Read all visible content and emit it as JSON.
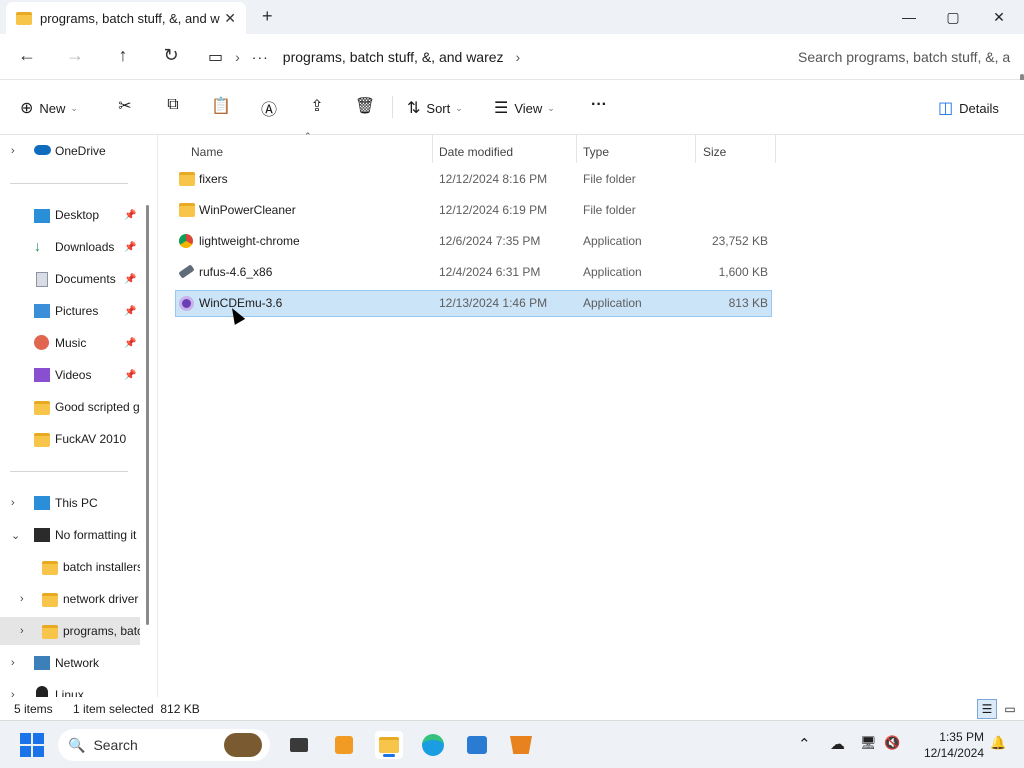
{
  "window": {
    "tab_title": "programs, batch stuff, &, and warez",
    "new_tab_glyph": "+",
    "tab_close_glyph": "✕",
    "minimize_glyph": "—",
    "maximize_glyph": "▢",
    "close_glyph": "✕"
  },
  "address": {
    "back_glyph": "←",
    "forward_glyph": "→",
    "up_glyph": "↑",
    "refresh_glyph": "↻",
    "monitor_glyph": "▭",
    "more_glyph": "···",
    "chevron_glyph": "›",
    "current_folder": "programs, batch stuff, &, and warez",
    "search_placeholder": "Search programs, batch stuff, &, a"
  },
  "commands": {
    "new_label": "New",
    "sort_label": "Sort",
    "view_label": "View",
    "details_label": "Details",
    "more_glyph": "···",
    "new_glyph": "⊕",
    "cut_glyph": "✂",
    "copy_glyph": "⧉",
    "paste_glyph": "📋",
    "rename_glyph": "Ⓐ",
    "share_glyph": "⇪",
    "delete_glyph": "🗑",
    "sort_glyph": "⇅",
    "view_glyph": "☰",
    "details_glyph": "◫",
    "caret": "⌄"
  },
  "sidebar": {
    "items": [
      {
        "label": "OneDrive",
        "chevron": "›"
      },
      {
        "label": "Desktop",
        "pin": "📌"
      },
      {
        "label": "Downloads",
        "pin": "📌"
      },
      {
        "label": "Documents",
        "pin": "📌"
      },
      {
        "label": "Pictures",
        "pin": "📌"
      },
      {
        "label": "Music",
        "pin": "📌"
      },
      {
        "label": "Videos",
        "pin": "📌"
      },
      {
        "label": "Good scripted g"
      },
      {
        "label": "FuckAV 2010"
      },
      {
        "label": "This PC",
        "chevron": "›"
      },
      {
        "label": "No formatting it",
        "chevron": "⌄"
      },
      {
        "label": "batch installers"
      },
      {
        "label": "network driver",
        "chevron": "›"
      },
      {
        "label": "programs, batc",
        "chevron": "›"
      },
      {
        "label": "Network",
        "chevron": "›"
      },
      {
        "label": "Linux",
        "chevron": "›"
      }
    ]
  },
  "columns": {
    "name": "Name",
    "date": "Date modified",
    "type": "Type",
    "size": "Size",
    "sort_glyph": "⌃"
  },
  "files": [
    {
      "name": "fixers",
      "date": "12/12/2024 8:16 PM",
      "type": "File folder",
      "size": "",
      "icon": "folder-icon"
    },
    {
      "name": "WinPowerCleaner",
      "date": "12/12/2024 6:19 PM",
      "type": "File folder",
      "size": "",
      "icon": "folder-icon"
    },
    {
      "name": "lightweight-chrome",
      "date": "12/6/2024 7:35 PM",
      "type": "Application",
      "size": "23,752 KB",
      "icon": "chrome-icon"
    },
    {
      "name": "rufus-4.6_x86",
      "date": "12/4/2024 6:31 PM",
      "type": "Application",
      "size": "1,600 KB",
      "icon": "usb-drive-icon"
    },
    {
      "name": "WinCDEmu-3.6",
      "date": "12/13/2024 1:46 PM",
      "type": "Application",
      "size": "813 KB",
      "icon": "disc-icon"
    }
  ],
  "status": {
    "item_count": "5 items",
    "selection": "1 item selected  812 KB"
  },
  "taskbar": {
    "search_label": "Search",
    "search_glyph": "🔍",
    "time": "1:35 PM",
    "date": "12/14/2024",
    "tray_up_glyph": "⌃",
    "tray_cloud_glyph": "☁",
    "tray_net_glyph": "🖥",
    "tray_vol_glyph": "🔇",
    "tray_bell_glyph": "🔔"
  },
  "colors": {
    "selection_bg": "#cce4f7",
    "selection_border": "#99c9ef",
    "folder": "#f6c54a",
    "accent": "#1a73e8"
  }
}
